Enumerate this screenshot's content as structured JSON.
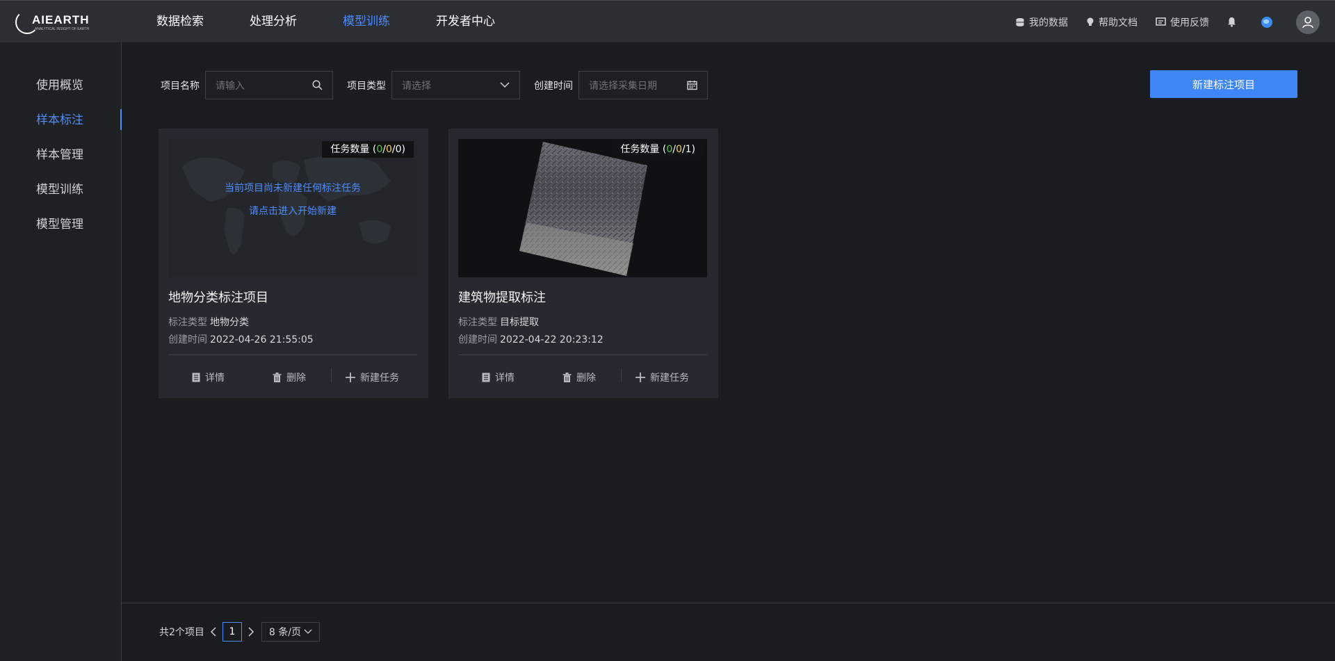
{
  "brand": {
    "name": "AIEARTH",
    "tagline": "ANALYTICAL INSIGHT OF EARTH"
  },
  "nav": {
    "items": [
      "数据检索",
      "处理分析",
      "模型训练",
      "开发者中心"
    ],
    "active": "模型训练"
  },
  "utility": {
    "my_data": "我的数据",
    "help_docs": "帮助文档",
    "feedback": "使用反馈"
  },
  "sidebar": {
    "items": [
      "使用概览",
      "样本标注",
      "样本管理",
      "模型训练",
      "模型管理"
    ],
    "active": "样本标注"
  },
  "filters": {
    "name_label": "项目名称",
    "name_placeholder": "请输入",
    "type_label": "项目类型",
    "type_placeholder": "请选择",
    "date_label": "创建时间",
    "date_placeholder": "请选择采集日期"
  },
  "new_project_button": "新建标注项目",
  "cards": [
    {
      "title": "地物分类标注项目",
      "badge_label": "任务数量 (",
      "count_a": "0",
      "count_b": "0",
      "count_total": "0",
      "empty_line1": "当前项目尚未新建任何标注任务",
      "empty_line2": "请点击进入开始新建",
      "type_label": "标注类型",
      "type_value": "地物分类",
      "time_label": "创建时间",
      "time_value": "2022-04-26 21:55:05",
      "actions": {
        "detail": "详情",
        "delete": "删除",
        "new_task": "新建任务"
      }
    },
    {
      "title": "建筑物提取标注",
      "badge_label": "任务数量 (",
      "count_a": "0",
      "count_b": "0",
      "count_total": "1",
      "type_label": "标注类型",
      "type_value": "目标提取",
      "time_label": "创建时间",
      "time_value": "2022-04-22 20:23:12",
      "actions": {
        "detail": "详情",
        "delete": "删除",
        "new_task": "新建任务"
      }
    }
  ],
  "pagination": {
    "total_text": "共2个项目",
    "current_page": "1",
    "page_size": "8 条/页"
  },
  "colors": {
    "accent": "#4f8cff",
    "button": "#3f86f7",
    "green": "#5ac34a",
    "yellow": "#f1d24a"
  }
}
